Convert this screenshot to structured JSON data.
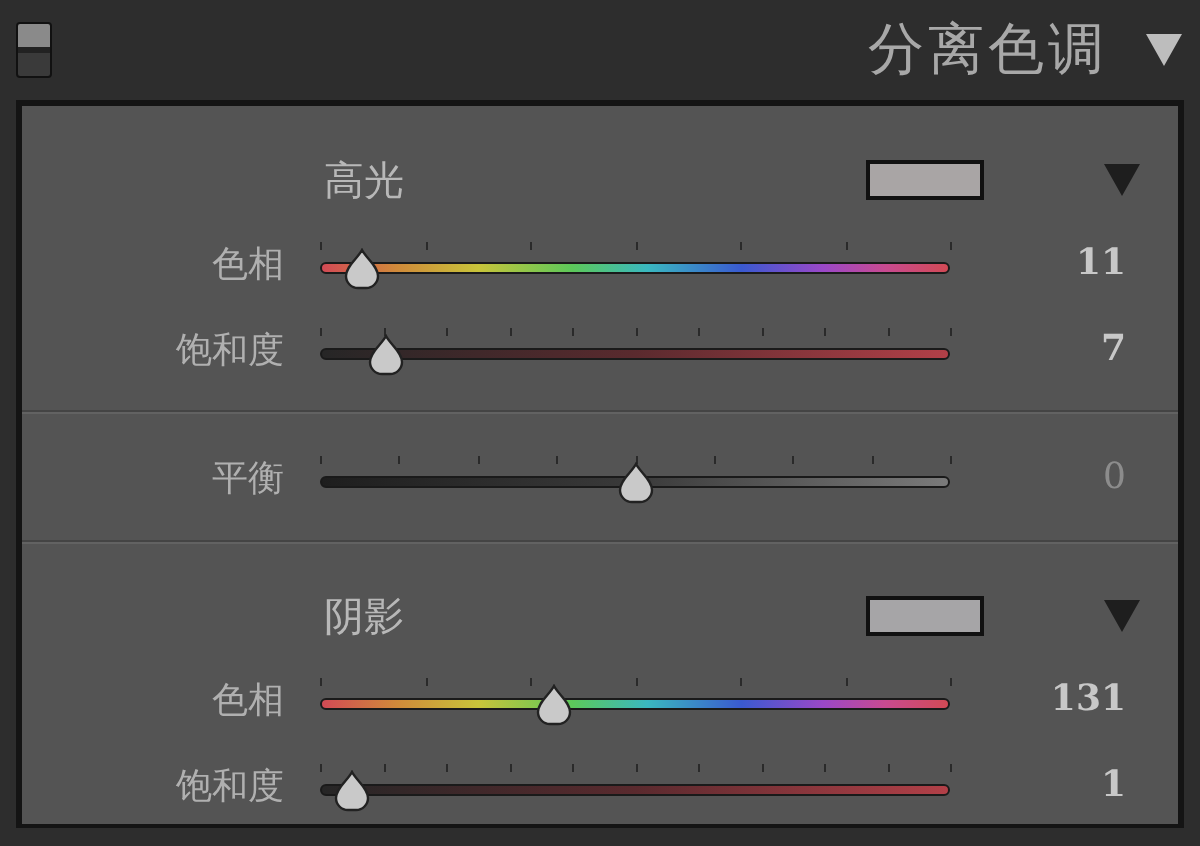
{
  "panel": {
    "title": "分离色调",
    "on": true
  },
  "sections": [
    {
      "kind": "tone",
      "title": "高光",
      "color": "#a9a5a5",
      "sliders": [
        {
          "kind": "hue",
          "label": "色相",
          "level": 0.067,
          "value": "11"
        },
        {
          "kind": "saturation",
          "label": "饱和度",
          "level": 0.105,
          "value": "7"
        }
      ]
    },
    {
      "kind": "plain",
      "sliders": [
        {
          "kind": "balance",
          "label": "平衡",
          "level": 0.5,
          "value": "0"
        }
      ]
    },
    {
      "kind": "tone",
      "title": "阴影",
      "color": "#a6a5a7",
      "sliders": [
        {
          "kind": "hue",
          "label": "色相",
          "level": 0.37,
          "value": "131"
        },
        {
          "kind": "saturation",
          "label": "饱和度",
          "level": 0.05,
          "value": "1"
        }
      ]
    }
  ]
}
